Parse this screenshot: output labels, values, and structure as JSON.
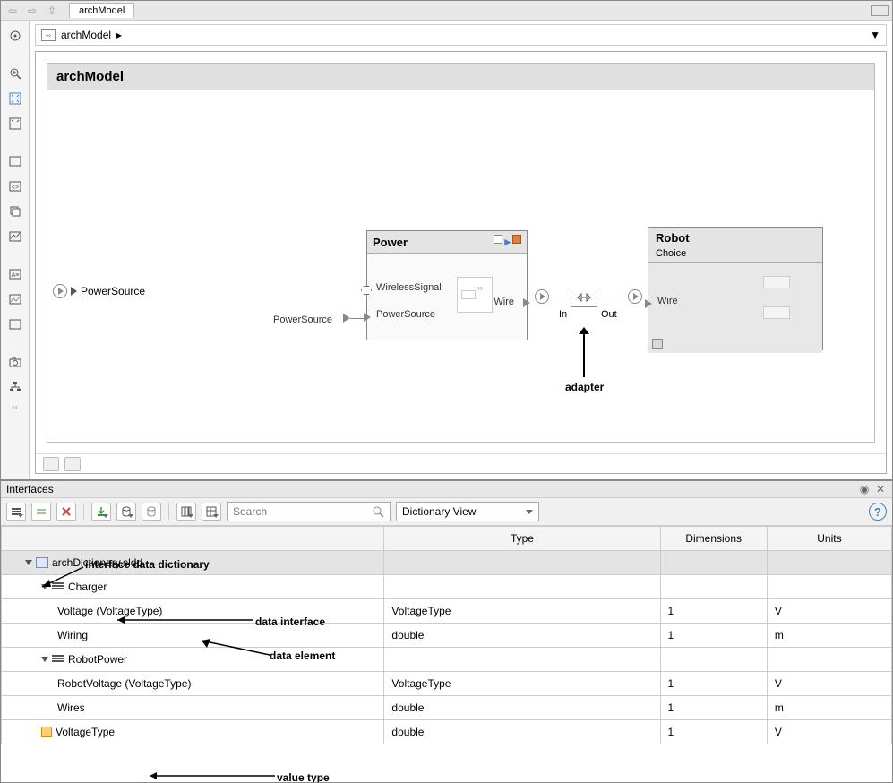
{
  "topnav": {
    "tab": "archModel"
  },
  "breadcrumb": {
    "model": "archModel"
  },
  "model": {
    "title": "archModel",
    "ext_port": "PowerSource",
    "ext_port2_label": "PowerSource",
    "power": {
      "title": "Power",
      "p_wireless": "WirelessSignal",
      "p_source": "PowerSource",
      "p_wire": "Wire"
    },
    "adapter": {
      "in": "In",
      "out": "Out"
    },
    "robot": {
      "title": "Robot",
      "subtitle": "Choice",
      "p_wire": "Wire"
    },
    "annotations": {
      "adapter": "adapter",
      "idd": "interface data dictionary",
      "di": "data interface",
      "de": "data element",
      "vt": "value type"
    }
  },
  "interfaces": {
    "title": "Interfaces",
    "search_placeholder": "Search",
    "view": "Dictionary View",
    "columns": {
      "c0": "",
      "c1": "Type",
      "c2": "Dimensions",
      "c3": "Units"
    },
    "rows": [
      {
        "name": "archDictionary.sldd",
        "type": "",
        "dim": "",
        "units": "",
        "kind": "dict"
      },
      {
        "name": "Charger",
        "type": "",
        "dim": "",
        "units": "",
        "kind": "interface"
      },
      {
        "name": "Voltage (VoltageType)",
        "type": "VoltageType",
        "dim": "1",
        "units": "V",
        "kind": "elem"
      },
      {
        "name": "Wiring",
        "type": "double",
        "dim": "1",
        "units": "m",
        "kind": "elem"
      },
      {
        "name": "RobotPower",
        "type": "",
        "dim": "",
        "units": "",
        "kind": "interface"
      },
      {
        "name": "RobotVoltage (VoltageType)",
        "type": "VoltageType",
        "dim": "1",
        "units": "V",
        "kind": "elem"
      },
      {
        "name": "Wires",
        "type": "double",
        "dim": "1",
        "units": "m",
        "kind": "elem"
      },
      {
        "name": "VoltageType",
        "type": "double",
        "dim": "1",
        "units": "V",
        "kind": "vtype"
      }
    ]
  }
}
